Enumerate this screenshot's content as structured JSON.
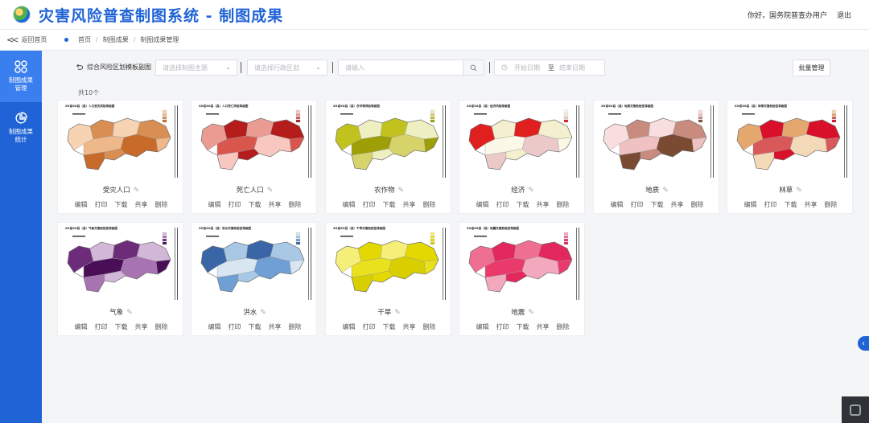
{
  "header": {
    "title": "灾害风险普查制图系统 - 制图成果",
    "greeting": "你好，国务院普查办用户",
    "logout": "退出",
    "accent": "#1f63d6"
  },
  "breadcrumb": {
    "back": "返回首页",
    "items": [
      "首页",
      "制图成果",
      "制图成果管理"
    ]
  },
  "sidebar": {
    "items": [
      {
        "label": "制图成果管理",
        "icon": "grid-icon",
        "active": true
      },
      {
        "label": "制图成果统计",
        "icon": "pie-chart-icon",
        "active": false
      }
    ]
  },
  "toolbar": {
    "template_link": "综合风险区划模板副图",
    "theme_placeholder": "请选择制图主题",
    "region_placeholder": "请选择行政区划",
    "search_placeholder": "请输入",
    "start_date_placeholder": "开始日期",
    "date_separator": "至",
    "end_date_placeholder": "结束日期",
    "batch_button": "批量管理"
  },
  "total_label": "共10个",
  "card_actions": [
    "编辑",
    "打印",
    "下载",
    "共享",
    "删除"
  ],
  "cards": [
    {
      "name": "受灾人口",
      "map_title": "XX省XX县（县）人口受灾风险等级图",
      "colors": [
        "#f6d3b3",
        "#eeb88a",
        "#d98e54",
        "#c76a2a"
      ]
    },
    {
      "name": "死亡人口",
      "map_title": "XX省XX县（县）人口死亡风险等级图",
      "colors": [
        "#f7c7c0",
        "#ea9b92",
        "#d9564d",
        "#b51c1c"
      ]
    },
    {
      "name": "农作物",
      "map_title": "XX省XX县（县）农作物风险等级图",
      "colors": [
        "#eef0c2",
        "#d6d36a",
        "#c2c21e",
        "#9e9e06"
      ]
    },
    {
      "name": "经济",
      "map_title": "XX省XX县（县）经济风险等级图",
      "colors": [
        "#fbf8e8",
        "#f3efcf",
        "#ebc9c9",
        "#e01f1f"
      ]
    },
    {
      "name": "地质",
      "map_title": "XX省XX县（县）地质灾害危险性等级图",
      "colors": [
        "#f8dede",
        "#efc1c1",
        "#c98b7d",
        "#7a4a33"
      ]
    },
    {
      "name": "林草",
      "map_title": "XX省XX县（县）林草灾害危险性等级图",
      "colors": [
        "#f3d9b8",
        "#e4a86e",
        "#d9585a",
        "#d8102a"
      ]
    },
    {
      "name": "气象",
      "map_title": "XX省XX县（县）气象灾害危险性等级图",
      "colors": [
        "#d2b7d8",
        "#a873b1",
        "#6c2c7a",
        "#4a0e57"
      ]
    },
    {
      "name": "洪水",
      "map_title": "XX省XX县（县）洪水灾害危险性等级图",
      "colors": [
        "#d8e6f2",
        "#a9c8e6",
        "#6f9fd4",
        "#3a66a8"
      ]
    },
    {
      "name": "干旱",
      "map_title": "XX省XX县（县）干旱灾害危险性等级图",
      "colors": [
        "#f5ef7a",
        "#e9e11e",
        "#e3d900",
        "#d9cf00"
      ]
    },
    {
      "name": "地震",
      "map_title": "XX省XX县（县）地震灾害危险性等级图",
      "colors": [
        "#f3a8bd",
        "#ef6f92",
        "#e93a6b",
        "#e2285c"
      ]
    }
  ]
}
